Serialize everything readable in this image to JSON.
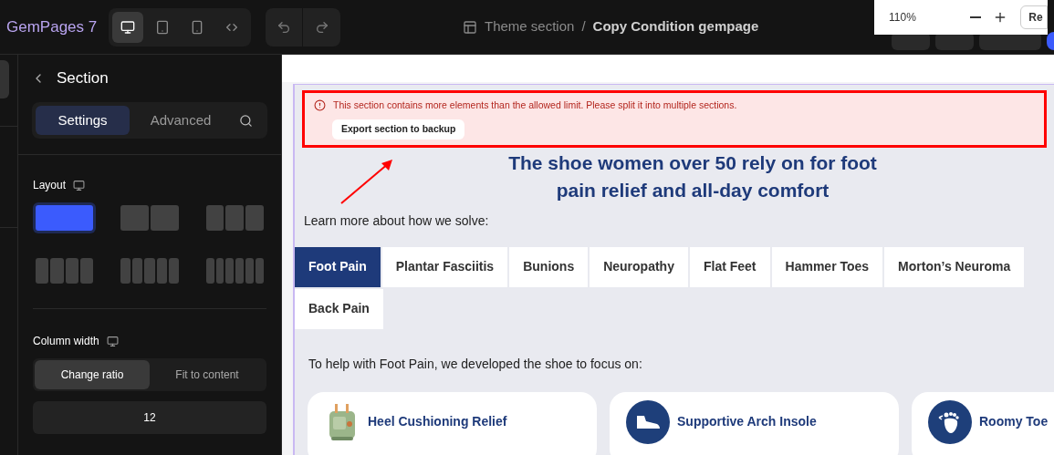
{
  "app": {
    "name": "GemPages 7"
  },
  "devices": [
    {
      "kind": "desktop",
      "selected": true
    },
    {
      "kind": "tablet",
      "selected": false
    },
    {
      "kind": "mobile",
      "selected": false
    },
    {
      "kind": "fit",
      "selected": false
    }
  ],
  "breadcrumb": {
    "parent": "Theme section",
    "separator": "/",
    "current": "Copy Condition gempage"
  },
  "zoom": {
    "value": "110%",
    "button": "Re"
  },
  "panel": {
    "title": "Section",
    "tabs": [
      {
        "label": "Settings",
        "selected": true
      },
      {
        "label": "Advanced",
        "selected": false
      }
    ],
    "layout": {
      "label": "Layout",
      "options": [
        {
          "kind": "one",
          "selected": true
        },
        {
          "kind": "two",
          "selected": false
        },
        {
          "kind": "three",
          "selected": false
        },
        {
          "kind": "four",
          "selected": false
        },
        {
          "kind": "five",
          "selected": false
        },
        {
          "kind": "six",
          "selected": false
        }
      ]
    },
    "column_width": {
      "label": "Column width",
      "modes": [
        {
          "label": "Change ratio",
          "selected": true
        },
        {
          "label": "Fit to content",
          "selected": false
        }
      ],
      "value": "12"
    }
  },
  "alert": {
    "message": "This section contains more elements than the allowed limit. Please split it into multiple sections.",
    "button": "Export section to backup"
  },
  "section": {
    "heading": [
      "The shoe women over 50 rely on for foot",
      "pain relief and all-day comfort"
    ],
    "intro": "Learn more about how we solve:",
    "tabs": [
      {
        "label": "Foot Pain",
        "selected": true
      },
      {
        "label": "Plantar Fasciitis",
        "selected": false
      },
      {
        "label": "Bunions",
        "selected": false
      },
      {
        "label": "Neuropathy",
        "selected": false
      },
      {
        "label": "Flat Feet",
        "selected": false
      },
      {
        "label": "Hammer Toes",
        "selected": false
      },
      {
        "label": "Morton’s Neuroma",
        "selected": false
      },
      {
        "label": "Back Pain",
        "selected": false
      }
    ],
    "focus_text": "To help with Foot Pain, we developed the shoe to focus on:",
    "cards": [
      {
        "title": "Heel Cushioning Relief",
        "kind": "picture"
      },
      {
        "title": "Supportive Arch Insole",
        "kind": "shoe"
      },
      {
        "title": "Roomy Toe",
        "kind": "foot"
      }
    ]
  }
}
